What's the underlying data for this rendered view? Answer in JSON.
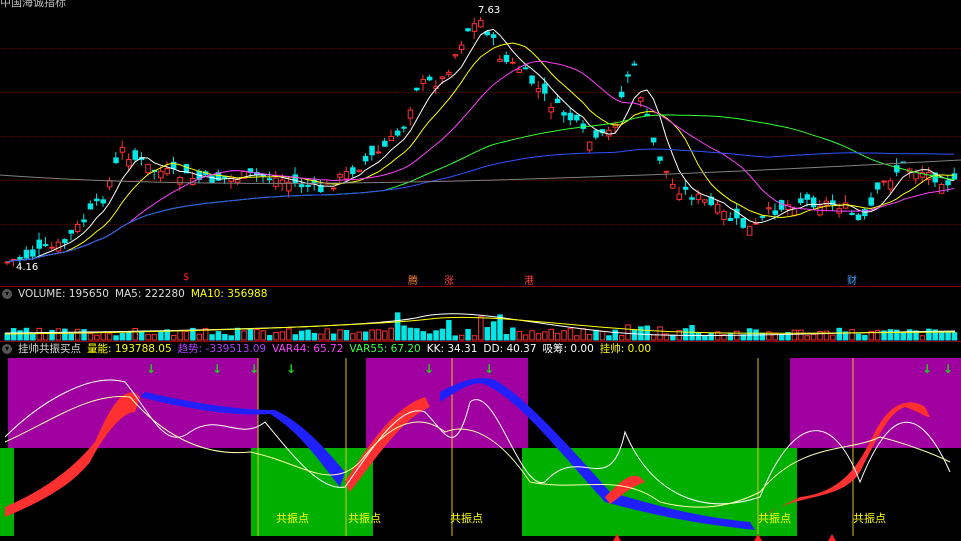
{
  "window": {
    "title": "中国海诚指标"
  },
  "price_panel": {
    "high_label": "7.63",
    "low_label": "4.16",
    "events": [
      {
        "text": "$",
        "color": "#ff2020"
      },
      {
        "text": "腾",
        "color": "#ff8040"
      },
      {
        "text": "涨",
        "color": "#ff4040"
      },
      {
        "text": "港",
        "color": "#ff4040"
      },
      {
        "text": "财",
        "color": "#40a0ff"
      }
    ]
  },
  "volume_panel": {
    "collapse_icon": "circle-chevron-icon",
    "label": "VOLUME: 195650",
    "ma5": "MA5: 222280",
    "ma10": "MA10: 356988"
  },
  "indicator_panel": {
    "collapse_icon": "circle-chevron-icon",
    "name": "挂帅共振买点",
    "items": [
      {
        "label": "量能: 193788.05",
        "color": "#ffff00"
      },
      {
        "label": "趋势: -339513.09",
        "color": "#a020f0"
      },
      {
        "label": "VAR44: 65.72",
        "color": "#ff40ff"
      },
      {
        "label": "VAR55: 67.20",
        "color": "#40ff40"
      },
      {
        "label": "KK: 34.31",
        "color": "#ffffff"
      },
      {
        "label": "DD: 40.37",
        "color": "#ffffff"
      },
      {
        "label": "吸筹: 0.00",
        "color": "#ffffff"
      },
      {
        "label": "挂帅: 0.00",
        "color": "#ffff00"
      }
    ],
    "signals": [
      "共振点",
      "共振点",
      "共振点",
      "共振点",
      "共振点"
    ]
  },
  "colors": {
    "up": "#ff3030",
    "down": "#00e5e5",
    "purple_zone": "#a000a0",
    "green_zone": "#00b000"
  }
}
